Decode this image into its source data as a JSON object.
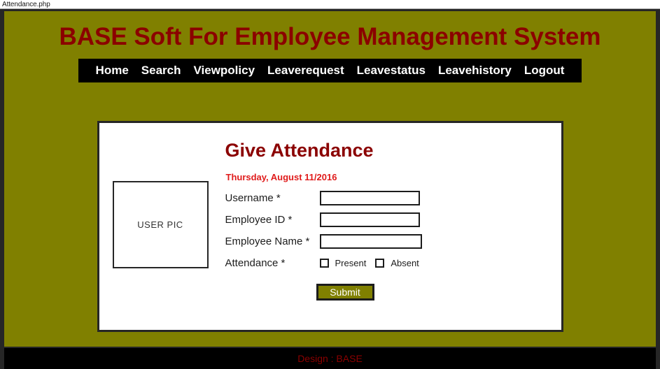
{
  "window": {
    "title": "Attendance.php"
  },
  "header": {
    "site_title": "BASE Soft For Employee Management System"
  },
  "nav": {
    "items": [
      {
        "label": "Home"
      },
      {
        "label": "Search"
      },
      {
        "label": "Viewpolicy"
      },
      {
        "label": "Leaverequest"
      },
      {
        "label": "Leavestatus"
      },
      {
        "label": "Leavehistory"
      },
      {
        "label": "Logout"
      }
    ]
  },
  "form": {
    "heading": "Give Attendance",
    "date": "Thursday, August 11/2016",
    "user_pic_placeholder": "USER PIC",
    "fields": [
      {
        "label": "Username *",
        "value": "",
        "placeholder": ""
      },
      {
        "label": "Employee ID *",
        "value": "",
        "placeholder": ""
      },
      {
        "label": "Employee Name *",
        "value": "",
        "placeholder": ""
      }
    ],
    "attendance": {
      "label": "Attendance *",
      "options": [
        {
          "label": "Present",
          "checked": false
        },
        {
          "label": "Absent",
          "checked": false
        }
      ]
    },
    "submit_label": "Submit"
  },
  "footer": {
    "text": "Design : BASE"
  },
  "colors": {
    "background_olive": "#808000",
    "heading_dark_red": "#8b0000",
    "date_red": "#e01b1b",
    "nav_black": "#000000",
    "card_white": "#ffffff",
    "border_dark": "#262626"
  }
}
